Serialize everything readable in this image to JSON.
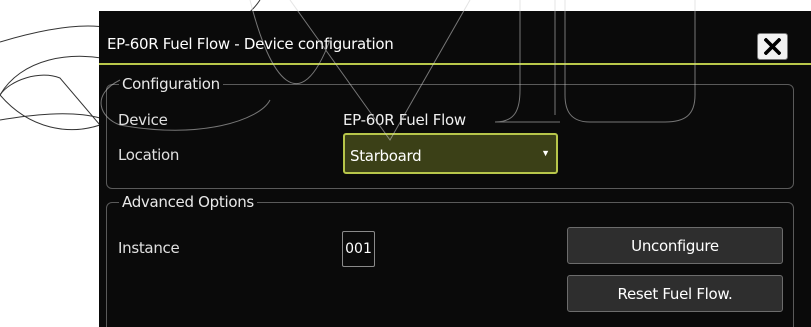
{
  "dialog": {
    "title": "EP-60R Fuel Flow - Device configuration",
    "close_icon": "close-icon",
    "accent_color": "#b9c84a",
    "background_color": "#0a0a0a"
  },
  "configuration": {
    "legend": "Configuration",
    "device_label": "Device",
    "device_value": "EP-60R Fuel Flow",
    "location_label": "Location",
    "location_value": "Starboard",
    "location_caret_icon": "caret-down-icon"
  },
  "advanced": {
    "legend": "Advanced Options",
    "instance_label": "Instance",
    "instance_value": "001",
    "unconfigure_label": "Unconfigure",
    "reset_label": "Reset Fuel Flow."
  }
}
